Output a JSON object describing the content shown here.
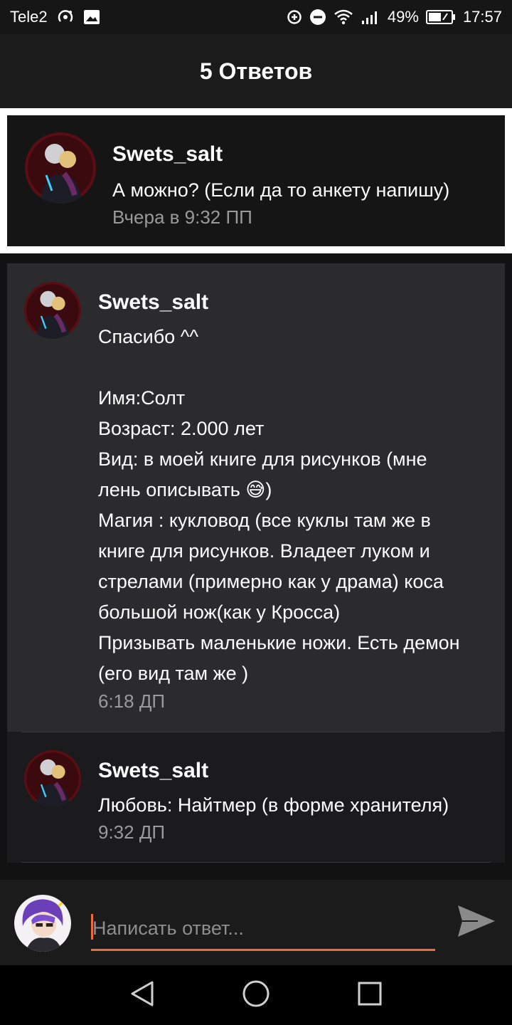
{
  "status_bar": {
    "carrier": "Tele2",
    "battery": "49%",
    "time": "17:57",
    "icons": [
      "hotspot-icon",
      "image-icon",
      "data-saver-icon",
      "dnd-icon",
      "wifi-icon",
      "signal-icon",
      "battery-icon"
    ]
  },
  "header": {
    "title": "5 Ответов"
  },
  "original_post": {
    "author": "Swets_salt",
    "text": "А можно? (Если да то анкету напишу)",
    "time": "Вчера в 9:32 ПП"
  },
  "replies": [
    {
      "author": "Swets_salt",
      "text": "Спасибо ^^\n\nИмя:Солт\nВозраст: 2.000 лет\nВид: в моей книге для рисунков (мне\nлень описывать 😅)\nМагия : кукловод (все куклы там же в\nкниге для рисунков. Владеет луком и\nстрелами (примерно как у драма) коса\nбольшой нож(как у Кросса)\nПризывать маленькие ножи. Есть демон\n(его вид там же )",
      "time": "6:18 ДП"
    },
    {
      "author": "Swets_salt",
      "text": "Любовь: Найтмер (в форме хранителя)",
      "time": "9:32 ДП"
    }
  ],
  "reply_bar": {
    "placeholder": "Написать ответ..."
  },
  "colors": {
    "accent": "#ef6a3a",
    "background": "#121213",
    "card_highlight": "#2b2a2d"
  }
}
